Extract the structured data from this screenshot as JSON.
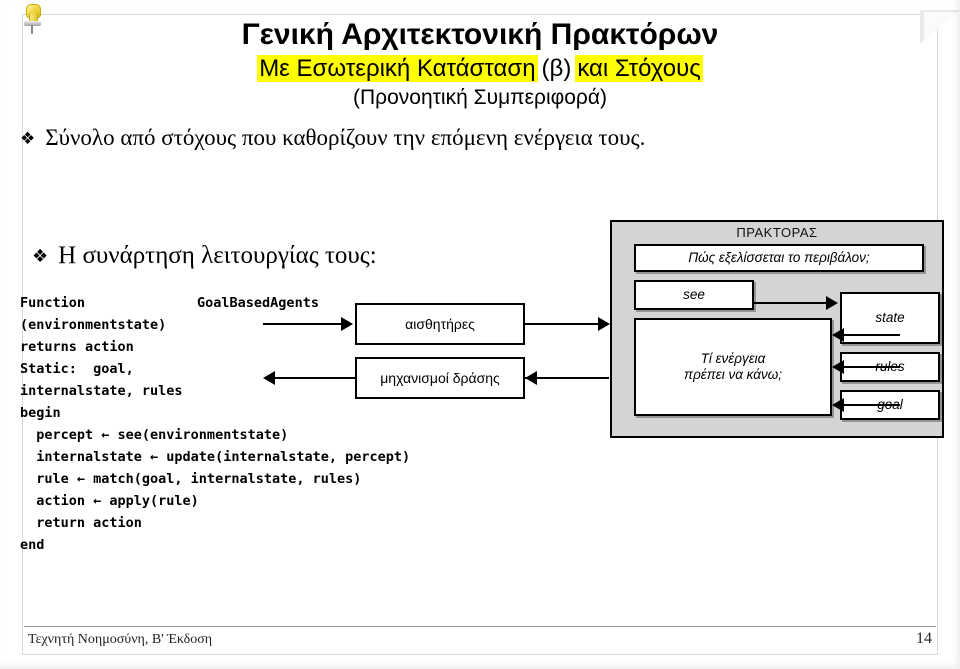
{
  "slide": {
    "title_line1": "Γενική Αρχιτεκτονική Πρακτόρων",
    "title_line2_a": "Με Εσωτερική Κατάσταση",
    "title_line2_b": "(β)",
    "title_line2_c": "και Στόχους",
    "title_line3": "(Προνοητική Συμπεριφορά)",
    "highlight_color": "#ffff00",
    "bullets": [
      {
        "marker": "❖",
        "text": "Σύνολο από στόχους που καθορίζουν την επόμενη ενέργεια τους."
      },
      {
        "marker": "❖",
        "text": "Η συνάρτηση λειτουργίας τους:"
      }
    ],
    "code": {
      "line1_left": "Function",
      "line1_right": "GoalBasedAgents",
      "lines": [
        "(environmentstate)",
        "returns action",
        "Static:  goal,",
        "internalstate, rules",
        "begin",
        "  percept ← see(environmentstate)",
        "  internalstate ← update(internalstate, percept)",
        "  rule ← match(goal, internalstate, rules)",
        "  action ← apply(rule)",
        "  return action",
        "end"
      ]
    },
    "diagram": {
      "sensors_label": "αισθητήρες",
      "actuators_label": "μηχανισμοί δράσης",
      "agent_title": "ΠΡΑΚΤΟΡΑΣ",
      "agent_bg": "#d4d4d4",
      "boxes": {
        "environment_question": "Πώς εξελίσσεται το περιβάλον;",
        "see": "see",
        "what_action_line1": "Τί ενέργεια",
        "what_action_line2": "πρέπει να κάνω;",
        "state": "state",
        "rules": "rules",
        "goal": "goal"
      }
    },
    "footer": {
      "left": "Τεχνητή Νοημοσύνη, Β' Έκδοση",
      "page_number": "14"
    }
  }
}
